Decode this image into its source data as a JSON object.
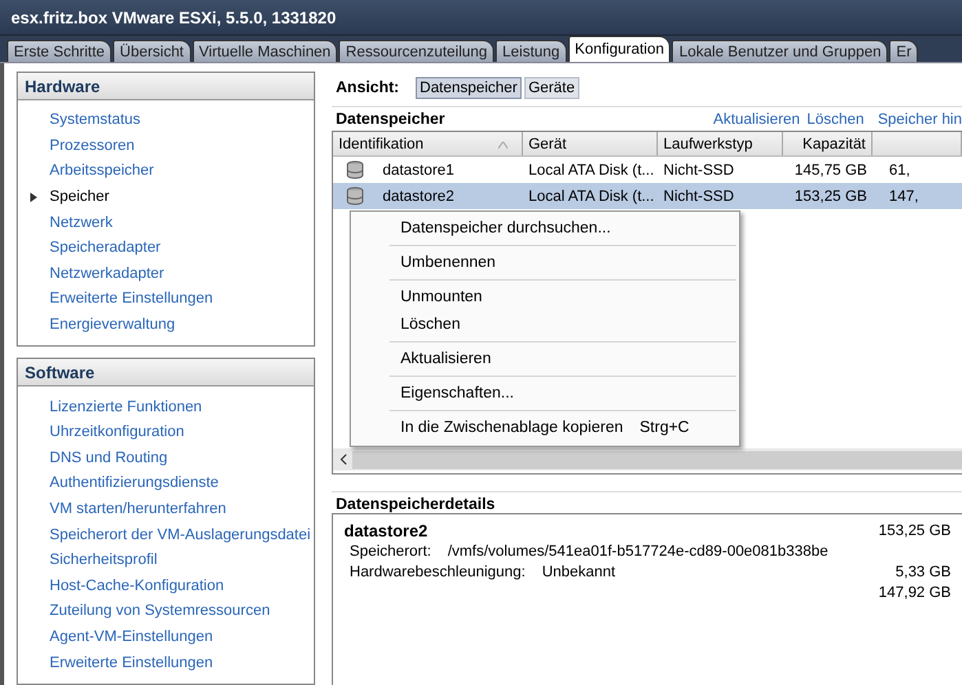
{
  "window": {
    "title": "esx.fritz.box VMware ESXi, 5.5.0, 1331820"
  },
  "tabs": [
    {
      "label": "Erste Schritte",
      "selected": false
    },
    {
      "label": "Übersicht",
      "selected": false
    },
    {
      "label": "Virtuelle Maschinen",
      "selected": false
    },
    {
      "label": "Ressourcenzuteilung",
      "selected": false
    },
    {
      "label": "Leistung",
      "selected": false
    },
    {
      "label": "Konfiguration",
      "selected": true
    },
    {
      "label": "Lokale Benutzer und Gruppen",
      "selected": false
    },
    {
      "label": "Er",
      "selected": false
    }
  ],
  "sidebar": {
    "sections": [
      {
        "title": "Hardware",
        "items": [
          {
            "label": "Systemstatus",
            "selected": false
          },
          {
            "label": "Prozessoren",
            "selected": false
          },
          {
            "label": "Arbeitsspeicher",
            "selected": false
          },
          {
            "label": "Speicher",
            "selected": true
          },
          {
            "label": "Netzwerk",
            "selected": false
          },
          {
            "label": "Speicheradapter",
            "selected": false
          },
          {
            "label": "Netzwerkadapter",
            "selected": false
          },
          {
            "label": "Erweiterte Einstellungen",
            "selected": false
          },
          {
            "label": "Energieverwaltung",
            "selected": false
          }
        ]
      },
      {
        "title": "Software",
        "items": [
          {
            "label": "Lizenzierte Funktionen",
            "selected": false
          },
          {
            "label": "Uhrzeitkonfiguration",
            "selected": false
          },
          {
            "label": "DNS und Routing",
            "selected": false
          },
          {
            "label": "Authentifizierungsdienste",
            "selected": false
          },
          {
            "label": "VM starten/herunterfahren",
            "selected": false
          },
          {
            "label": "Speicherort der VM-Auslagerungsdatei",
            "selected": false
          },
          {
            "label": "Sicherheitsprofil",
            "selected": false
          },
          {
            "label": "Host-Cache-Konfiguration",
            "selected": false
          },
          {
            "label": "Zuteilung von Systemressourcen",
            "selected": false
          },
          {
            "label": "Agent-VM-Einstellungen",
            "selected": false
          },
          {
            "label": "Erweiterte Einstellungen",
            "selected": false
          }
        ]
      }
    ]
  },
  "view": {
    "label": "Ansicht:",
    "options": [
      {
        "label": "Datenspeicher",
        "selected": true
      },
      {
        "label": "Geräte",
        "selected": false
      }
    ]
  },
  "datastores": {
    "title": "Datenspeicher",
    "actions": [
      "Aktualisieren",
      "Löschen",
      "Speicher hin"
    ],
    "columns": [
      "Identifikation",
      "Gerät",
      "Laufwerkstyp",
      "Kapazität"
    ],
    "rows": [
      {
        "cells": [
          "datastore1",
          "Local ATA Disk (t...",
          "Nicht-SSD",
          "145,75 GB",
          "61,"
        ],
        "selected": false
      },
      {
        "cells": [
          "datastore2",
          "Local ATA Disk (t...",
          "Nicht-SSD",
          "153,25 GB",
          "147,"
        ],
        "selected": true
      }
    ]
  },
  "context_menu": {
    "groups": [
      [
        "Datenspeicher durchsuchen..."
      ],
      [
        "Umbenennen"
      ],
      [
        "Unmounten",
        "Löschen"
      ],
      [
        "Aktualisieren"
      ],
      [
        "Eigenschaften..."
      ],
      [
        {
          "label": "In die Zwischenablage kopieren",
          "shortcut": "Strg+C"
        }
      ]
    ]
  },
  "details": {
    "title": "Datenspeicherdetails",
    "name": "datastore2",
    "capacity": "153,25 GB",
    "fields": [
      {
        "label": "Speicherort:",
        "value": "/vmfs/volumes/541ea01f-b517724e-cd89-00e081b338be"
      },
      {
        "label": "Hardwarebeschleunigung:",
        "value": "Unbekannt",
        "amount": "5,33 GB"
      }
    ],
    "free": "147,92 GB"
  }
}
